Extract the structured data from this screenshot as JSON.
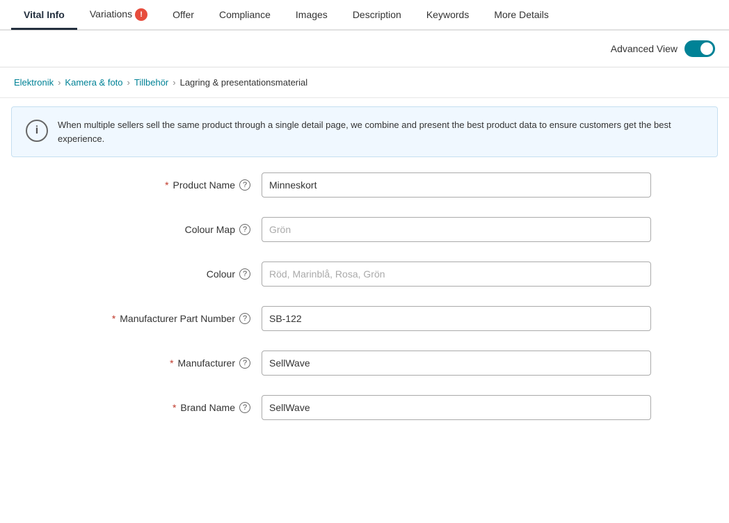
{
  "tabs": [
    {
      "id": "vital-info",
      "label": "Vital Info",
      "active": true,
      "badge": null
    },
    {
      "id": "variations",
      "label": "Variations",
      "active": false,
      "badge": "!"
    },
    {
      "id": "offer",
      "label": "Offer",
      "active": false,
      "badge": null
    },
    {
      "id": "compliance",
      "label": "Compliance",
      "active": false,
      "badge": null
    },
    {
      "id": "images",
      "label": "Images",
      "active": false,
      "badge": null
    },
    {
      "id": "description",
      "label": "Description",
      "active": false,
      "badge": null
    },
    {
      "id": "keywords",
      "label": "Keywords",
      "active": false,
      "badge": null
    },
    {
      "id": "more-details",
      "label": "More Details",
      "active": false,
      "badge": null
    }
  ],
  "advanced_view": {
    "label": "Advanced View",
    "enabled": true
  },
  "breadcrumb": {
    "items": [
      {
        "label": "Elektronik",
        "link": true
      },
      {
        "label": "Kamera & foto",
        "link": true
      },
      {
        "label": "Tillbehör",
        "link": true
      },
      {
        "label": "Lagring & presentationsmaterial",
        "link": false
      }
    ]
  },
  "info_banner": {
    "text": "When multiple sellers sell the same product through a single detail page, we combine and present the best product data to ensure customers get the best experience."
  },
  "form": {
    "fields": [
      {
        "id": "product-name",
        "label": "Product Name",
        "required": true,
        "value": "Minneskort",
        "placeholder": ""
      },
      {
        "id": "colour-map",
        "label": "Colour Map",
        "required": false,
        "value": "",
        "placeholder": "Grön"
      },
      {
        "id": "colour",
        "label": "Colour",
        "required": false,
        "value": "",
        "placeholder": "Röd, Marinblå, Rosa, Grön"
      },
      {
        "id": "manufacturer-part-number",
        "label": "Manufacturer Part Number",
        "required": true,
        "value": "SB-122",
        "placeholder": ""
      },
      {
        "id": "manufacturer",
        "label": "Manufacturer",
        "required": true,
        "value": "SellWave",
        "placeholder": ""
      },
      {
        "id": "brand-name",
        "label": "Brand Name",
        "required": true,
        "value": "SellWave",
        "placeholder": ""
      }
    ]
  }
}
